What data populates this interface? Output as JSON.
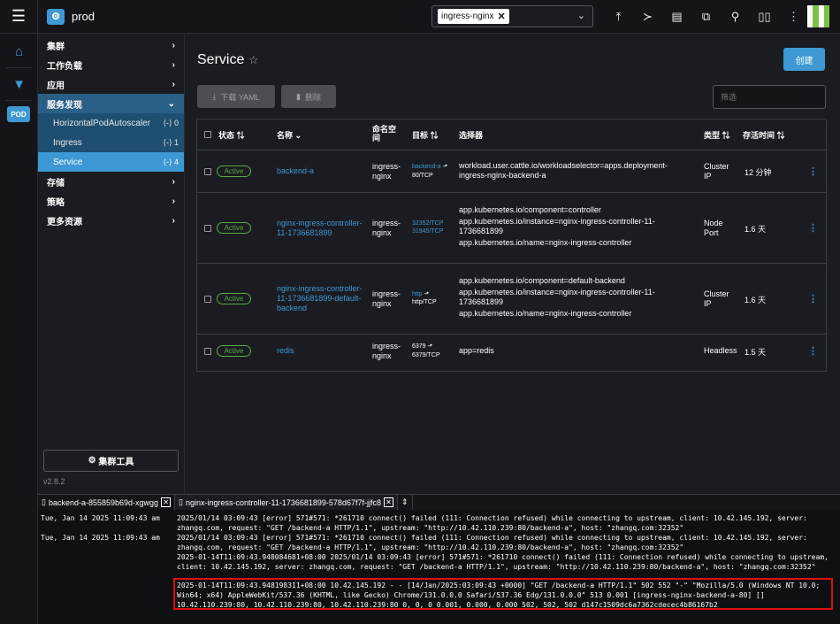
{
  "topbar": {
    "cluster_name": "prod",
    "namespace_chip": "ingress-nginx"
  },
  "leftstrip": {
    "pod_label": "POD"
  },
  "sidebar": {
    "items": [
      {
        "label": "集群",
        "expanded": false
      },
      {
        "label": "工作负载",
        "expanded": false
      },
      {
        "label": "应用",
        "expanded": false
      },
      {
        "label": "服务发现",
        "expanded": true
      },
      {
        "label": "存储",
        "expanded": false
      },
      {
        "label": "策略",
        "expanded": false
      },
      {
        "label": "更多资源",
        "expanded": false
      }
    ],
    "subitems": [
      {
        "label": "HorizontalPodAutoscaler",
        "count": "0"
      },
      {
        "label": "Ingress",
        "count": "1"
      },
      {
        "label": "Service",
        "count": "4",
        "active": true
      }
    ],
    "cluster_tools": "集群工具",
    "version": "v2.8.2"
  },
  "main": {
    "title": "Service",
    "create": "创建",
    "download_yaml": "下载 YAML",
    "delete": "删除",
    "filter_placeholder": "筛选",
    "headers": {
      "state": "状态",
      "name": "名称",
      "namespace": "命名空间",
      "target": "目标",
      "selector": "选择器",
      "type": "类型",
      "age": "存活时间"
    },
    "rows": [
      {
        "state": "Active",
        "name": "backend-a",
        "namespace": "ingress-nginx",
        "target": [
          "backend-a",
          "80/TCP"
        ],
        "selector": [
          "workload.user.cattle.io/workloadselector=apps.deployment-ingress-nginx-backend-a"
        ],
        "type": "Cluster IP",
        "age": "12 分钟"
      },
      {
        "state": "Active",
        "name": "nginx-ingress-controller-11-1736681899",
        "namespace": "ingress-nginx",
        "target": [
          "32352/TCP",
          "31945/TCP"
        ],
        "selector": [
          "app.kubernetes.io/component=controller",
          "app.kubernetes.io/instance=nginx-ingress-controller-11-1736681899",
          "app.kubernetes.io/name=nginx-ingress-controller"
        ],
        "type": "Node Port",
        "age": "1.6 天"
      },
      {
        "state": "Active",
        "name": "nginx-ingress-controller-11-1736681899-default-backend",
        "namespace": "ingress-nginx",
        "target": [
          "http",
          "http/TCP"
        ],
        "selector": [
          "app.kubernetes.io/component=default-backend",
          "app.kubernetes.io/instance=nginx-ingress-controller-11-1736681899",
          "app.kubernetes.io/name=nginx-ingress-controller"
        ],
        "type": "Cluster IP",
        "age": "1.6 天"
      },
      {
        "state": "Active",
        "name": "redis",
        "namespace": "ingress-nginx",
        "target": [
          "6379",
          "6379/TCP"
        ],
        "selector": [
          "app=redis"
        ],
        "type": "Headless",
        "age": "1.5 天"
      }
    ]
  },
  "logs": {
    "tabs": [
      "backend-a-855859b69d-xgwgg",
      "nginx-ingress-controller-11-1736681899-578d67f7f-jjfc8"
    ],
    "lines": [
      {
        "ts": "Tue, Jan 14 2025 11:09:43 am",
        "msg": "2025/01/14 03:09:43 [error] 571#571: *261710 connect() failed (111: Connection refused) while connecting to upstream, client: 10.42.145.192, server: zhangq.com, request: \"GET /backend-a HTTP/1.1\", upstream: \"http://10.42.110.239:80/backend-a\", host: \"zhangq.com:32352\""
      },
      {
        "ts": "Tue, Jan 14 2025 11:09:43 am",
        "msg": "2025/01/14 03:09:43 [error] 571#571: *261710 connect() failed (111: Connection refused) while connecting to upstream, client: 10.42.145.192, server: zhangq.com, request: \"GET /backend-a HTTP/1.1\", upstream: \"http://10.42.110.239:80/backend-a\", host: \"zhangq.com:32352\""
      },
      {
        "ts": "",
        "msg": "2025-01-14T11:09:43.948084681+08:00 2025/01/14 03:09:43 [error] 571#571: *261710 connect() failed (111: Connection refused) while connecting to upstream, client: 10.42.145.192, server: zhangq.com, request: \"GET /backend-a HTTP/1.1\", upstream: \"http://10.42.110.239:80/backend-a\", host: \"zhangq.com:32352\""
      },
      {
        "ts": "",
        "msg": "2025-01-14T11:09:43.948198311+08:00 10.42.145.192 - - [14/Jan/2025:03:09:43 +0000] \"GET /backend-a HTTP/1.1\" 502 552 \"-\" \"Mozilla/5.0 (Windows NT 10.0; Win64; x64) AppleWebKit/537.36 (KHTML, like Gecko) Chrome/131.0.0.0 Safari/537.36 Edg/131.0.0.0\" 513 0.001 [ingress-nginx-backend-a-80] [] 10.42.110.239:80, 10.42.110.239:80, 10.42.110.239:80 0, 0, 0 0.001, 0.000, 0.000 502, 502, 502 d147c1509dc6a7362cdecec4b86167b2"
      }
    ]
  }
}
